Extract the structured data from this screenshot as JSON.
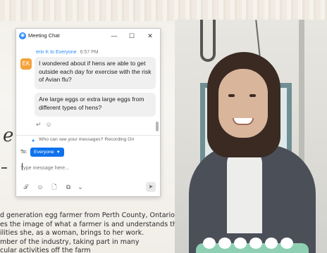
{
  "chat_window": {
    "title": "Meeting Chat",
    "controls": {
      "minimize": "—",
      "maximize": "☐",
      "close": "✕"
    },
    "message": {
      "sender": "erin K to Everyone",
      "time": "6:57 PM",
      "avatar_initials": "EK",
      "bubble1": "I wondered about if hens are able to get outside each day for exercise with the risk of Avian flu?",
      "bubble2": "Are large eggs or extra large eggs from different types of hens?"
    },
    "notice": "Who can see your messages? Recording On",
    "to_label": "To:",
    "recipient": "Everyone",
    "input": {
      "value": "",
      "placeholder": "Type message here..."
    },
    "toolbar": {
      "format": "𝒯",
      "emoji": "☺",
      "file": "🗋",
      "screenshot": "⧉",
      "more": "⌄",
      "send": "➤"
    },
    "colors": {
      "accent": "#2d8cff",
      "chip": "#0e72ed",
      "avatar": "#f4a23a"
    }
  },
  "background_article": {
    "script_fragment": "e",
    "lines": [
      "d generation egg farmer from Perth County, Ontario",
      "es the image of what a farmer is and understands the",
      "ilities she, as a woman, brings to her work.",
      "mber of the industry, taking part in many",
      "cular activities off the farm"
    ]
  }
}
